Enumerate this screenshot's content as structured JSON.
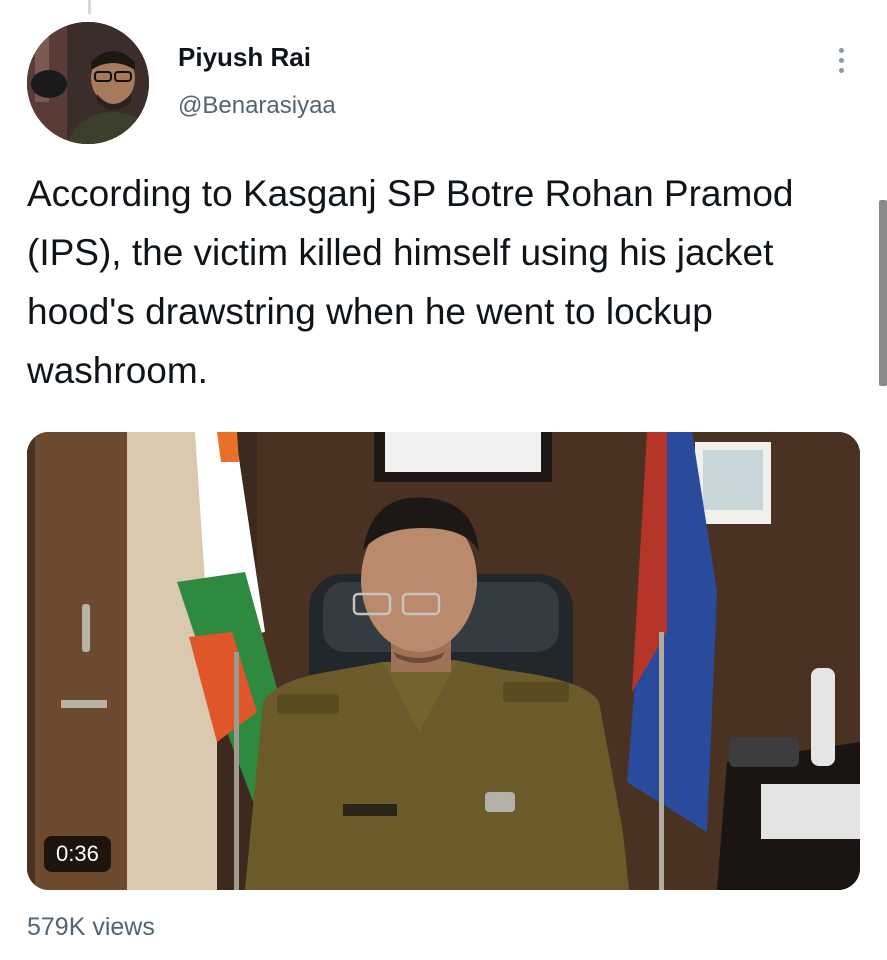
{
  "tweet": {
    "author_name": "Piyush Rai",
    "author_handle": "@Benarasiyaa",
    "text": "According to Kasganj SP Botre Rohan Pramod (IPS), the victim killed himself using his jacket hood's drawstring when he went to lockup washroom.",
    "video_duration": "0:36",
    "views": "579K views"
  },
  "icons": {
    "more": "more-vertical-icon",
    "avatar": "avatar-photo"
  },
  "colors": {
    "text": "#0f1419",
    "secondary": "#536471"
  }
}
